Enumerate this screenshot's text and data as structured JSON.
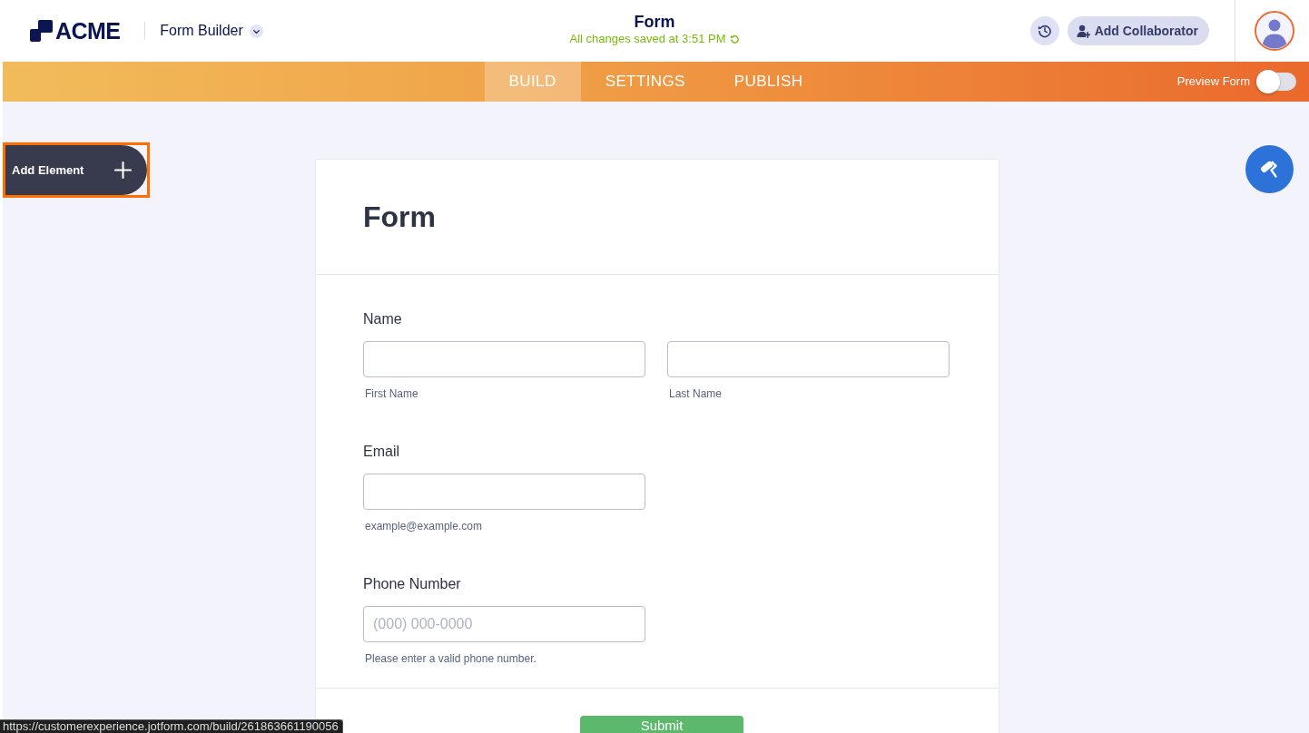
{
  "header": {
    "logo": "ACME",
    "app_name": "Form Builder",
    "form_name": "Form",
    "save_status": "All changes saved at 3:51 PM",
    "add_collaborator": "Add Collaborator"
  },
  "tabs": [
    {
      "label": "BUILD",
      "selected": true
    },
    {
      "label": "SETTINGS",
      "selected": false
    },
    {
      "label": "PUBLISH",
      "selected": false
    }
  ],
  "preview_toggle": {
    "label": "Preview Form",
    "on": false
  },
  "add_element": {
    "label": "Add Element"
  },
  "form": {
    "title": "Form",
    "fields": [
      {
        "label": "Name",
        "inputs": [
          {
            "sublabel": "First Name"
          },
          {
            "sublabel": "Last Name"
          }
        ]
      },
      {
        "label": "Email",
        "inputs": [
          {
            "sublabel": "example@example.com"
          }
        ]
      },
      {
        "label": "Phone Number",
        "inputs": [
          {
            "placeholder": "(000) 000-0000",
            "sublabel": "Please enter a valid phone number."
          }
        ]
      }
    ],
    "submit": "Submit"
  },
  "status_bar": {
    "url": "https://customerexperience.jotform.com/build/261863661190056"
  }
}
